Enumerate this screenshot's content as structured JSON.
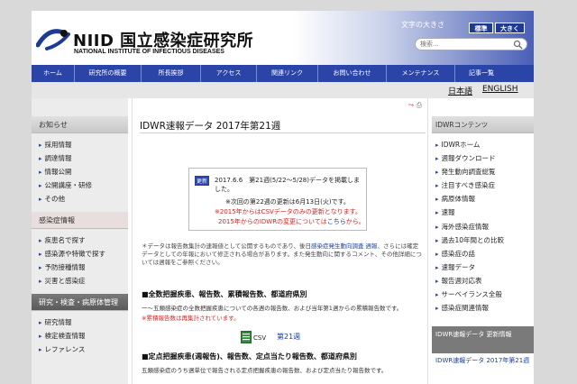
{
  "header": {
    "logo_main": "NIID 国立感染症研究所",
    "logo_sub": "NATIONAL INSTITUTE OF INFECTIOUS DISEASES",
    "text_size_label": "文字の大きさ",
    "text_size_normal": "標準",
    "text_size_large": "大きく",
    "search_placeholder": "検索..."
  },
  "nav": {
    "items": [
      "ホーム",
      "研究所の概要",
      "所長挨拶",
      "アクセス",
      "関連リンク",
      "お問い合わせ",
      "メンテナンス",
      "記事一覧"
    ]
  },
  "lang": {
    "ja": "日本語",
    "en": "ENGLISH"
  },
  "left": {
    "section1": "お知らせ",
    "items1": [
      "採用情報",
      "調達情報",
      "情報公開",
      "公開講座・研修",
      "その他"
    ],
    "section2": "感染症情報",
    "items2": [
      "疾患名で探す",
      "感染源や特徴で探す",
      "予防接種情報",
      "災害と感染症"
    ],
    "section3": "研究・検査・病原体管理",
    "items3": [
      "研究情報",
      "検定検査情報",
      "レファレンス"
    ]
  },
  "main": {
    "title": "IDWR速報データ 2017年第21週",
    "update_badge": "更新",
    "update_text": "2017.6.6　第21週(5/22〜5/28)データを掲載しました。",
    "next_update": "※次回の第22週の更新は6月13日(火)です。",
    "red_note1": "※2015年からはCSVデータのみの更新となります。",
    "red_note2_prefix": "2015年からのIDWRの変更については",
    "red_note2_link": "こちら",
    "red_note2_suffix": "から。",
    "data_note_1": "＊データは報告数集計の速報値として公開するものであり、後日",
    "data_note_link": "感染症発生動向調査 週報",
    "data_note_2": "、さらには確定データとしての年報において修正される場合があります。また発生動向に関するコメント、その他詳細については週報をご参照ください。",
    "section1_title": "■全数把握疾患、報告数、累積報告数、都道府県別",
    "section1_text": "一〜五類感染症の全数把握疾患についての各週の報告数、および当年第1週からの累積報告数です。",
    "section1_red": "※累積報告数は再集計されています。",
    "csv_label": "CSV",
    "csv_link": "第21週",
    "section2_title": "■定点把握疾患(週報告)、報告数、定点当たり報告数、都道府県別",
    "section2_text": "五類感染症のうち週単位で報告される定点把握疾患の報告数、および定点当たり報告数です。"
  },
  "right": {
    "header": "IDWRコンテンツ",
    "items": [
      "IDWRホーム",
      "週報ダウンロード",
      "発生動向調査総覧",
      "注目すべき感染症",
      "病原体情報",
      "速報",
      "海外感染症情報",
      "過去10年間との比較",
      "感染症の話",
      "速報データ",
      "報告週対応表",
      "サーベイランス全般",
      "感染症関連情報"
    ],
    "updates_header": "IDWR速報データ 更新情報",
    "updates_link": "IDWR速報データ 2017年第21週"
  }
}
